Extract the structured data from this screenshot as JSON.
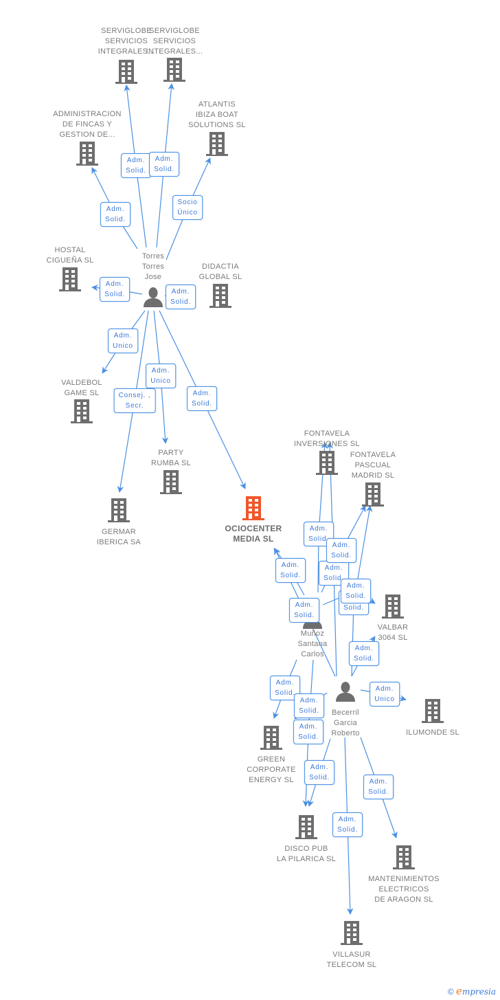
{
  "colors": {
    "company": "#6e6e6e",
    "main_company": "#f0562b",
    "person": "#6e6e6e",
    "edge": "#4a90e2",
    "label_text": "#3b78d8"
  },
  "nodes": [
    {
      "id": "serviglobe1",
      "type": "company",
      "lines": [
        "SERVIGLOBE",
        "SERVICIOS",
        "INTEGRALES..."
      ]
    },
    {
      "id": "serviglobe2",
      "type": "company",
      "lines": [
        "SERVIGLOBE",
        "SERVICIOS",
        "INTEGRALES..."
      ]
    },
    {
      "id": "administracion",
      "type": "company",
      "lines": [
        "ADMINISTRACION",
        "DE FINCAS Y",
        "GESTION DE..."
      ]
    },
    {
      "id": "atlantis",
      "type": "company",
      "lines": [
        "ATLANTIS",
        "IBIZA BOAT",
        "SOLUTIONS  SL"
      ]
    },
    {
      "id": "hostal",
      "type": "company",
      "lines": [
        "HOSTAL",
        "CIGUEÑA SL"
      ]
    },
    {
      "id": "didactia",
      "type": "company",
      "lines": [
        "DIDACTIA",
        "GLOBAL  SL"
      ]
    },
    {
      "id": "torres",
      "type": "person",
      "lines": [
        "Torres",
        "Torres",
        "Jose"
      ]
    },
    {
      "id": "valdebol",
      "type": "company",
      "lines": [
        "VALDEBOL",
        "GAME  SL"
      ]
    },
    {
      "id": "party",
      "type": "company",
      "lines": [
        "PARTY",
        "RUMBA  SL"
      ]
    },
    {
      "id": "germar",
      "type": "company",
      "lines": [
        "GERMAR",
        "IBERICA SA"
      ]
    },
    {
      "id": "ociocenter",
      "type": "main",
      "lines": [
        "OCIOCENTER",
        "MEDIA  SL"
      ]
    },
    {
      "id": "fontavela_inv",
      "type": "company",
      "lines": [
        "FONTAVELA",
        "INVERSIONES SL"
      ]
    },
    {
      "id": "fontavela_pas",
      "type": "company",
      "lines": [
        "FONTAVELA",
        "PASCUAL",
        "MADRID SL"
      ]
    },
    {
      "id": "valbar",
      "type": "company",
      "lines": [
        "VALBAR",
        "3064 SL"
      ]
    },
    {
      "id": "munoz",
      "type": "person",
      "lines": [
        "Muñoz",
        "Santana",
        "Carlos"
      ]
    },
    {
      "id": "becerril",
      "type": "person",
      "lines": [
        "Becerril",
        "Garcia",
        "Roberto"
      ]
    },
    {
      "id": "ilumonde",
      "type": "company",
      "lines": [
        "ILUMONDE SL"
      ]
    },
    {
      "id": "green",
      "type": "company",
      "lines": [
        "GREEN",
        "CORPORATE",
        "ENERGY SL"
      ]
    },
    {
      "id": "disco",
      "type": "company",
      "lines": [
        "DISCO PUB",
        "LA PILARICA SL"
      ]
    },
    {
      "id": "mantenimientos",
      "type": "company",
      "lines": [
        "MANTENIMIENTOS",
        "ELECTRICOS",
        "DE ARAGON SL"
      ]
    },
    {
      "id": "villasur",
      "type": "company",
      "lines": [
        "VILLASUR",
        "TELECOM SL"
      ]
    }
  ],
  "edges": [
    {
      "from": "torres",
      "to": "serviglobe1",
      "label": [
        "Adm.",
        "Solid."
      ]
    },
    {
      "from": "torres",
      "to": "serviglobe2",
      "label": [
        "Adm.",
        "Solid."
      ]
    },
    {
      "from": "torres",
      "to": "administracion",
      "label": [
        "Adm.",
        "Solid."
      ]
    },
    {
      "from": "torres",
      "to": "atlantis",
      "label": [
        "Socio",
        "Único"
      ]
    },
    {
      "from": "torres",
      "to": "hostal",
      "label": [
        "Adm.",
        "Solid."
      ]
    },
    {
      "from": "torres",
      "to": "didactia",
      "label": [
        "Adm.",
        "Solid."
      ]
    },
    {
      "from": "torres",
      "to": "valdebol",
      "label": [
        "Adm.",
        "Unico"
      ]
    },
    {
      "from": "torres",
      "to": "party",
      "label": [
        "Adm.",
        "Unico"
      ]
    },
    {
      "from": "torres",
      "to": "germar",
      "label": [
        "Consej. ,",
        "Secr."
      ]
    },
    {
      "from": "torres",
      "to": "ociocenter",
      "label": [
        "Adm.",
        "Solid."
      ]
    },
    {
      "from": "munoz",
      "to": "fontavela_inv",
      "label": [
        "Adm.",
        "Solid."
      ]
    },
    {
      "from": "becerril",
      "to": "fontavela_inv",
      "label": [
        "Adm.",
        "Solid."
      ]
    },
    {
      "from": "munoz",
      "to": "fontavela_pas",
      "label": [
        "Adm.",
        "Solid."
      ]
    },
    {
      "from": "becerril",
      "to": "fontavela_pas",
      "label": [
        "Adm.",
        "Solid."
      ]
    },
    {
      "from": "munoz",
      "to": "ociocenter",
      "label": [
        "Adm.",
        "Solid."
      ]
    },
    {
      "from": "becerril",
      "to": "ociocenter",
      "label": [
        "Adm.",
        "Solid."
      ]
    },
    {
      "from": "munoz",
      "to": "valbar",
      "label": [
        "Adm.",
        "Solid."
      ]
    },
    {
      "from": "becerril",
      "to": "valbar",
      "label": [
        "Adm.",
        "Solid."
      ]
    },
    {
      "from": "becerril",
      "to": "ilumonde",
      "label": [
        "Adm.",
        "Unico"
      ]
    },
    {
      "from": "munoz",
      "to": "green",
      "label": [
        "Adm.",
        "Solid."
      ]
    },
    {
      "from": "becerril",
      "to": "green",
      "label": [
        "Adm.",
        "Solid."
      ]
    },
    {
      "from": "munoz",
      "to": "disco",
      "label": [
        "Adm.",
        "Solid."
      ]
    },
    {
      "from": "becerril",
      "to": "disco",
      "label": [
        "Adm.",
        "Solid."
      ]
    },
    {
      "from": "becerril",
      "to": "mantenimientos",
      "label": [
        "Adm.",
        "Solid."
      ]
    },
    {
      "from": "becerril",
      "to": "villasur",
      "label": [
        "Adm.",
        "Solid."
      ]
    }
  ],
  "footer": {
    "copyright": "©",
    "brand_initial": "e",
    "brand_rest": "mpresia"
  }
}
